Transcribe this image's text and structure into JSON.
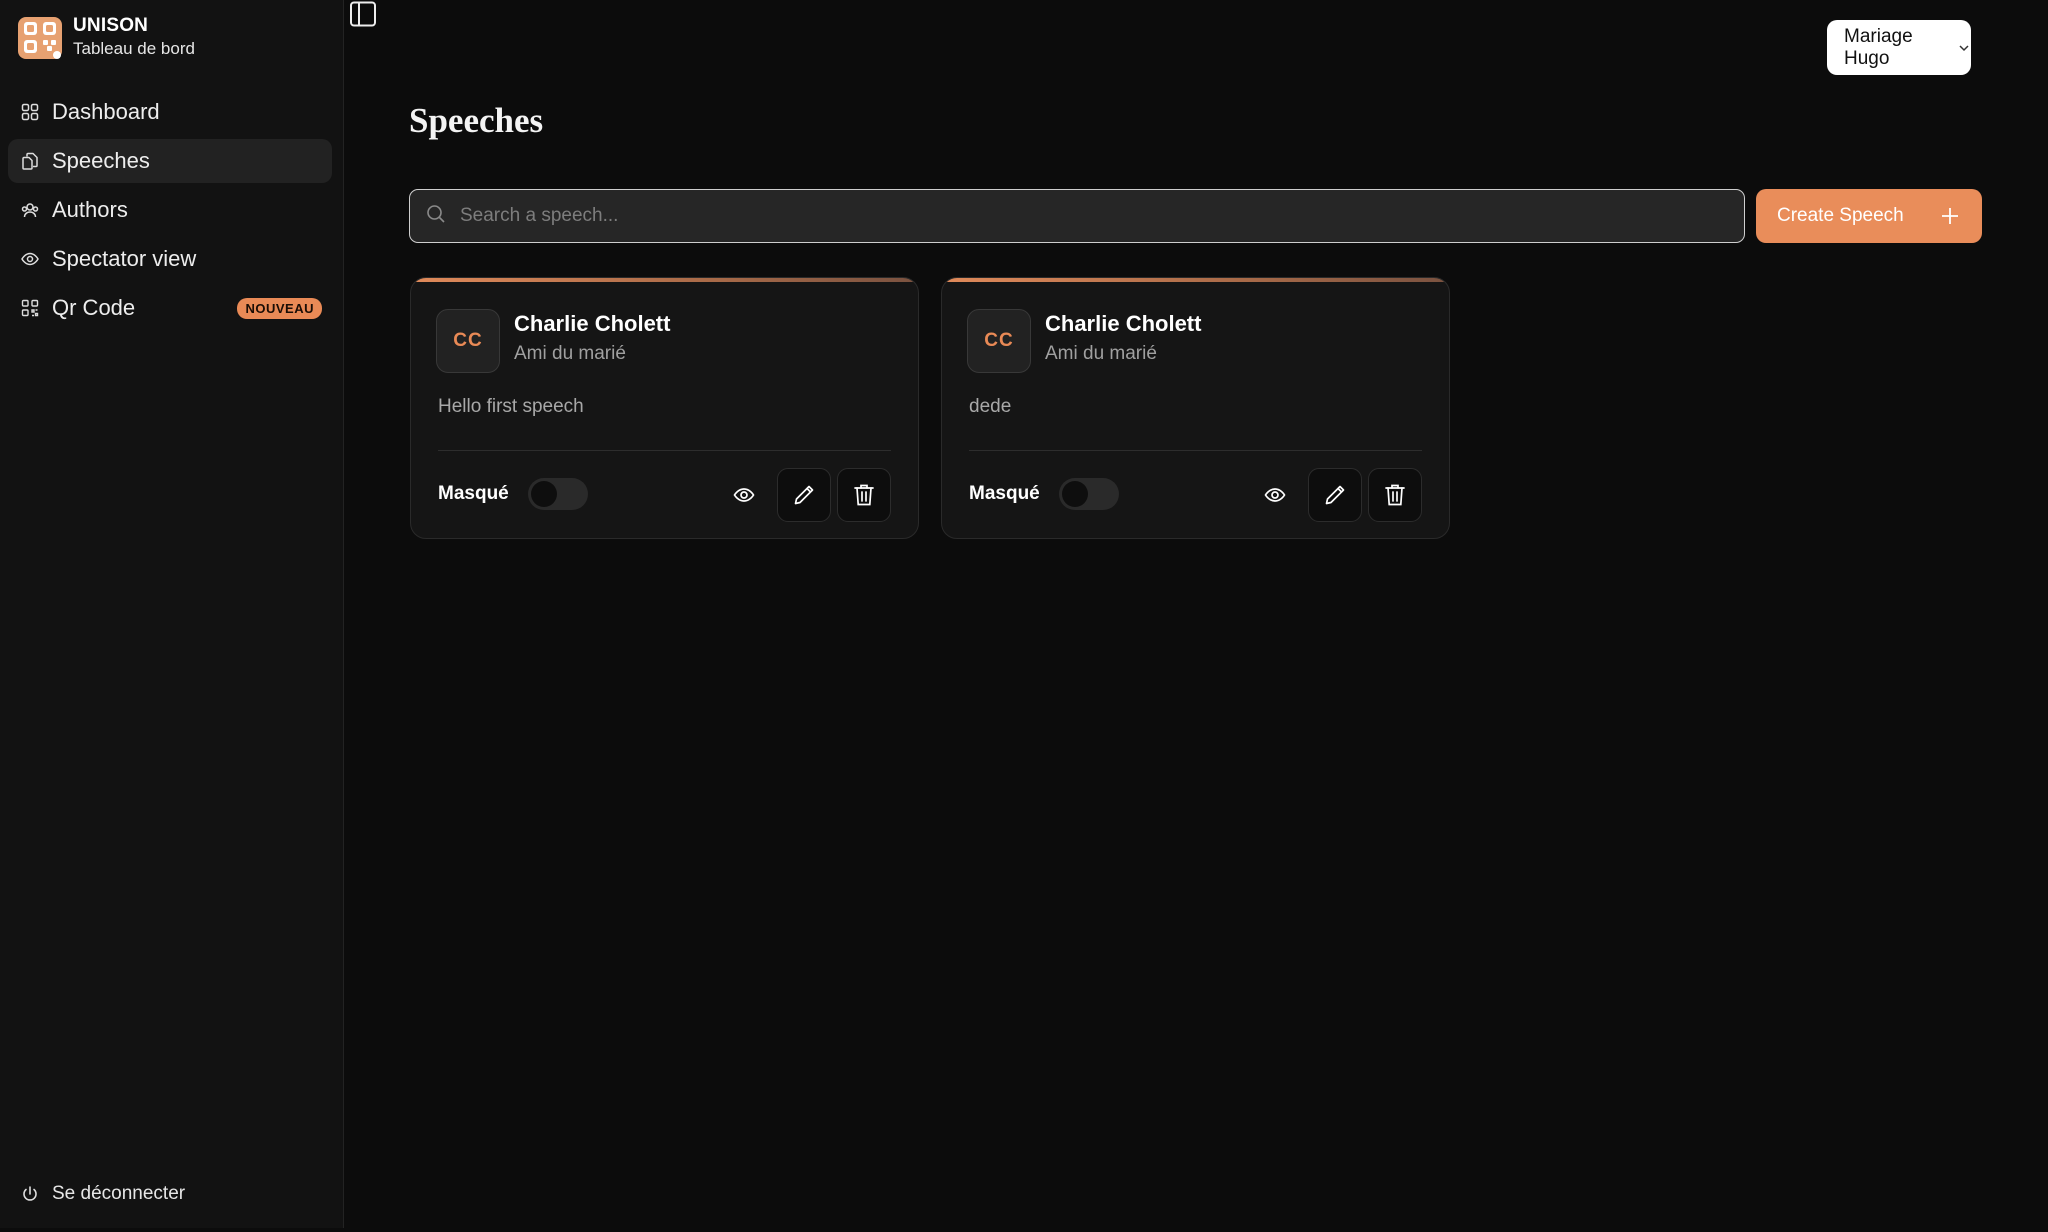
{
  "brand": {
    "name": "UNISON",
    "subtitle": "Tableau de bord",
    "logo_icon": "qr-logo-icon"
  },
  "sidebar": {
    "items": [
      {
        "label": "Dashboard",
        "icon": "grid-icon",
        "active": false
      },
      {
        "label": "Speeches",
        "icon": "documents-icon",
        "active": true
      },
      {
        "label": "Authors",
        "icon": "users-icon",
        "active": false
      },
      {
        "label": "Spectator view",
        "icon": "eye-icon",
        "active": false
      },
      {
        "label": "Qr Code",
        "icon": "qr-code-icon",
        "active": false,
        "badge": "NOUVEAU"
      }
    ],
    "logout_label": "Se déconnecter"
  },
  "header": {
    "project_selector": "Mariage Hugo"
  },
  "main": {
    "title": "Speeches",
    "search": {
      "placeholder": "Search a speech...",
      "value": ""
    },
    "create_button": "Create Speech"
  },
  "speeches": [
    {
      "initials": "CC",
      "author": "Charlie Cholett",
      "role": "Ami du marié",
      "text": "Hello first speech",
      "visibility_label": "Masqué",
      "visible": false
    },
    {
      "initials": "CC",
      "author": "Charlie Cholett",
      "role": "Ami du marié",
      "text": "dede",
      "visibility_label": "Masqué",
      "visible": false
    }
  ],
  "colors": {
    "accent": "#e98d5a",
    "background": "#0c0c0c",
    "sidebar": "#121212",
    "card": "#151515"
  }
}
